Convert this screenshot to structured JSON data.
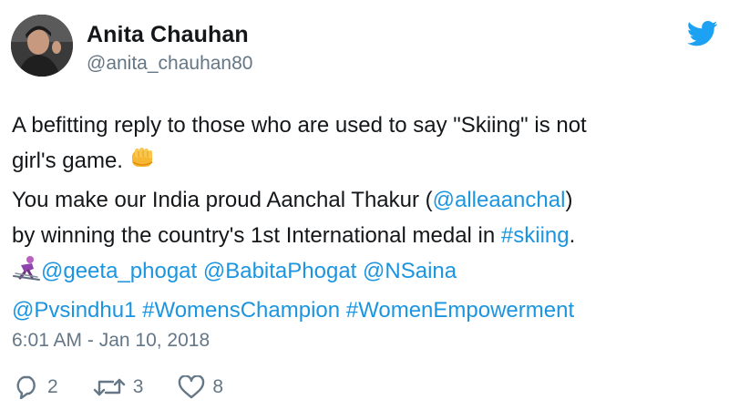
{
  "user": {
    "name": "Anita Chauhan",
    "handle": "@anita_chauhan80"
  },
  "tweet": {
    "line1": "A befitting reply to those who are used to say \"Skiing\" is not",
    "line2": "girl's game.",
    "line3_text": "You make our India proud Aanchal Thakur (",
    "line3_mention": "@alleaanchal",
    "line3_end": ")",
    "line4_text": "by winning the country's 1st International medal in ",
    "line4_hashtag": "#skiing",
    "line4_end": ".",
    "mention_geeta": "@geeta_phogat",
    "mention_babita": "@BabitaPhogat",
    "mention_nsaina": "@NSaina",
    "mention_pvsindhu": "@Pvsindhu1",
    "hashtag_champion": "#WomensChampion",
    "hashtag_empowerment": "#WomenEmpowerment",
    "emojis": [
      "oncoming-fist-emoji",
      "skier-emoji"
    ]
  },
  "timestamp": "6:01 AM - Jan 10, 2018",
  "actions": {
    "replies": "2",
    "retweets": "3",
    "likes": "8"
  },
  "icons": [
    "twitter-bird-icon",
    "reply-icon",
    "retweet-icon",
    "like-icon"
  ],
  "colors": {
    "link": "#1b95e0",
    "secondary_text": "#657786",
    "brand": "#1da1f2"
  }
}
